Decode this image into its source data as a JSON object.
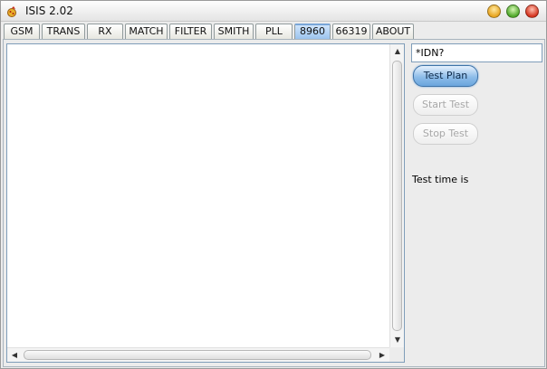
{
  "window": {
    "title": "ISIS 2.02"
  },
  "tabs": [
    {
      "label": "GSM"
    },
    {
      "label": "TRANS"
    },
    {
      "label": "RX"
    },
    {
      "label": "MATCH"
    },
    {
      "label": "FILTER"
    },
    {
      "label": "SMITH"
    },
    {
      "label": "PLL"
    },
    {
      "label": "8960"
    },
    {
      "label": "66319"
    },
    {
      "label": "ABOUT"
    }
  ],
  "active_tab": "8960",
  "main": {
    "command_input": {
      "value": "*IDN?"
    },
    "test_plan_label": "Test Plan",
    "start_test_label": "Start Test",
    "stop_test_label": "Stop Test",
    "test_time_label": "Test time is"
  },
  "colors": {
    "active_tab": "#9cc4ee",
    "primary_button": "#8ebde9",
    "disabled_text": "#a8a8a8"
  },
  "icons": {
    "app": "app-logo-icon",
    "minimize": "minimize-icon",
    "maximize": "maximize-icon",
    "close": "close-icon"
  }
}
